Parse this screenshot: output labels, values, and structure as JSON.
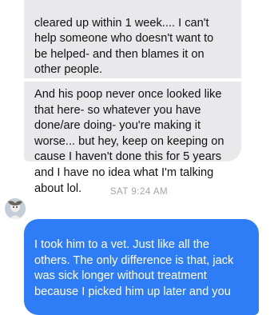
{
  "conversation": {
    "incoming_message_1": {
      "lines": [
        "...",
        "cleared up within 1 week.... I can't",
        "help someone who doesn't want to",
        "be helped- and then blames it on",
        "other people."
      ]
    },
    "incoming_message_2": {
      "lines": [
        "And his poop never once looked like",
        "that here- so whatever you have",
        "done/are doing- you're making it",
        "worse... but hey, keep on keeping on",
        "cause I haven't done this for 5 years",
        "and I have no idea what I'm talking",
        "about lol."
      ]
    },
    "timestamp": "SAT 9:24 AM",
    "outgoing_message_1": {
      "lines": [
        "I took him to a vet. Just like all the",
        "others. The only difference is that, jack",
        "was sick longer without treatment",
        "because I picked him up later and you"
      ]
    }
  },
  "colors": {
    "incoming_bubble": "#e9e9eb",
    "outgoing_bubble": "#2f7df6",
    "timestamp_text": "#a3a3a8"
  },
  "icons": {
    "sender_avatar": "avatar-icon"
  }
}
